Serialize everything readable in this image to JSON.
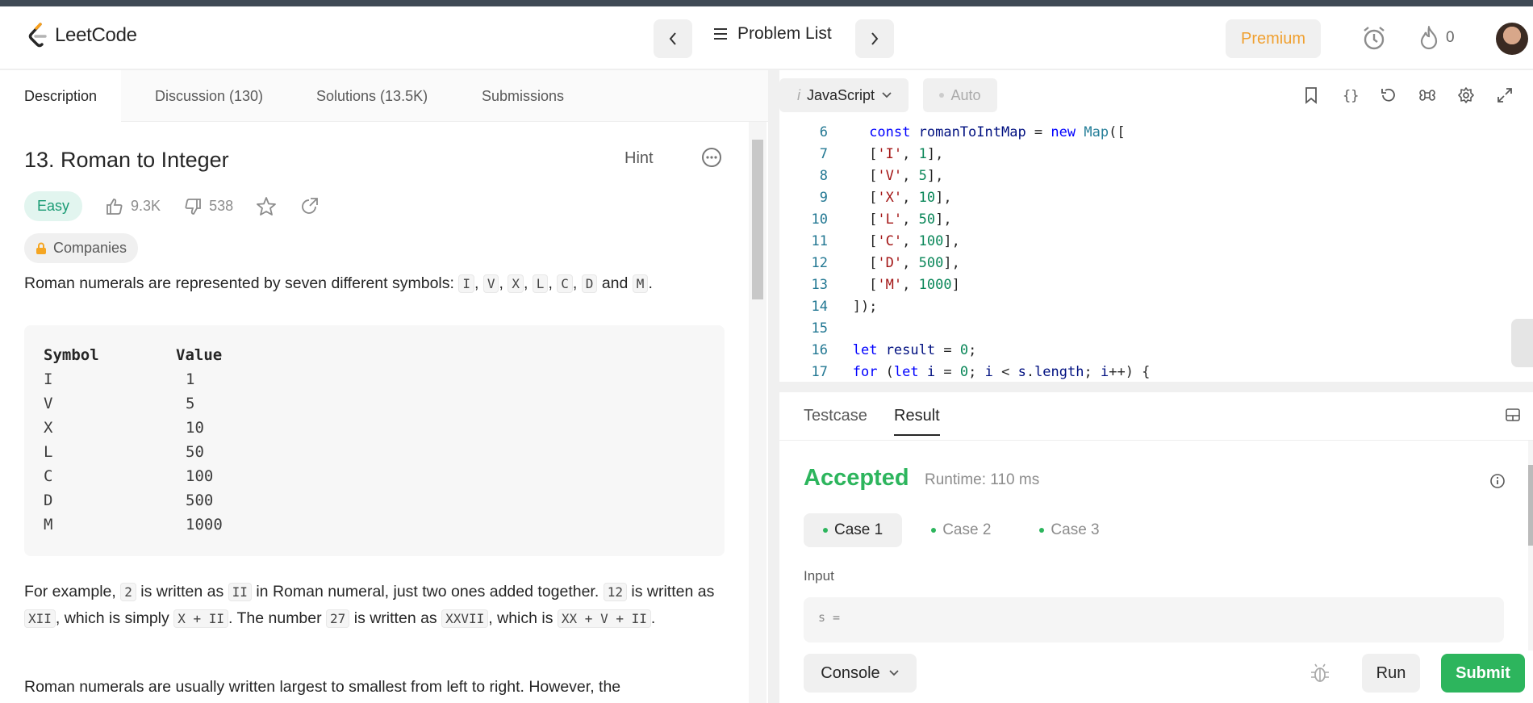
{
  "header": {
    "brand": "LeetCode",
    "problem_list": "Problem List",
    "premium": "Premium",
    "streak_count": "0"
  },
  "left": {
    "tabs": [
      "Description",
      "Discussion (130)",
      "Solutions (13.5K)",
      "Submissions"
    ],
    "title": "13. Roman to Integer",
    "hint": "Hint",
    "difficulty": "Easy",
    "likes": "9.3K",
    "dislikes": "538",
    "companies": "Companies",
    "intro_text": "Roman numerals are represented by seven different symbols:",
    "symbols": [
      "I",
      "V",
      "X",
      "L",
      "C",
      "D",
      "M"
    ],
    "and": "and",
    "table_header": [
      "Symbol",
      "Value"
    ],
    "table_rows": [
      [
        "I",
        "1"
      ],
      [
        "V",
        "5"
      ],
      [
        "X",
        "10"
      ],
      [
        "L",
        "50"
      ],
      [
        "C",
        "100"
      ],
      [
        "D",
        "500"
      ],
      [
        "M",
        "1000"
      ]
    ],
    "example_p1": "For example,",
    "example_c1": "2",
    "example_p2": "is written as",
    "example_c2": "II",
    "example_p3": "in Roman numeral, just two ones added together.",
    "example_c3": "12",
    "example_p4": "is written as",
    "example_c4": "XII",
    "example_p5": ", which is simply",
    "example_c5": "X + II",
    "example_p6": ". The number",
    "example_c6": "27",
    "example_p7": "is written as",
    "example_c7": "XXVII",
    "example_p8": ", which is",
    "example_c8": "XX + V + II",
    "example_p9": ".",
    "last_para": "Roman numerals are usually written largest to smallest from left to right. However, the"
  },
  "editor": {
    "language": "JavaScript",
    "auto": "Auto",
    "lines": [
      {
        "n": "6",
        "code": "const romanToIntMap = new Map(["
      },
      {
        "n": "7",
        "code": "['I', 1],"
      },
      {
        "n": "8",
        "code": "['V', 5],"
      },
      {
        "n": "9",
        "code": "['X', 10],"
      },
      {
        "n": "10",
        "code": "['L', 50],"
      },
      {
        "n": "11",
        "code": "['C', 100],"
      },
      {
        "n": "12",
        "code": "['D', 500],"
      },
      {
        "n": "13",
        "code": "['M', 1000]"
      },
      {
        "n": "14",
        "code": "]);"
      },
      {
        "n": "15",
        "code": ""
      },
      {
        "n": "16",
        "code": "let result = 0;"
      },
      {
        "n": "17",
        "code": "for (let i = 0; i < s.length; i++) {"
      }
    ]
  },
  "result": {
    "tabs": [
      "Testcase",
      "Result"
    ],
    "status": "Accepted",
    "runtime": "Runtime: 110 ms",
    "cases": [
      "Case 1",
      "Case 2",
      "Case 3"
    ],
    "input_label": "Input",
    "input_value": "s ="
  },
  "footer": {
    "console": "Console",
    "run": "Run",
    "submit": "Submit"
  },
  "colors": {
    "accent_green": "#2db55d",
    "easy_teal": "#1a9b74",
    "premium_orange": "#f0a030"
  }
}
